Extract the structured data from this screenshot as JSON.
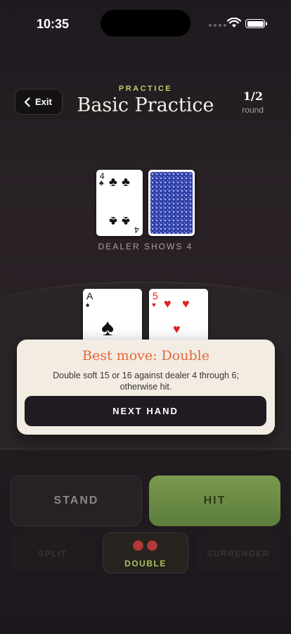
{
  "status": {
    "time": "10:35"
  },
  "header": {
    "exit_label": "Exit",
    "mode": "PRACTICE",
    "title": "Basic Practice",
    "round_count": "1/2",
    "round_label": "round"
  },
  "dealer": {
    "up_card": {
      "rank": "4",
      "suit": "♣"
    },
    "hole_card": "face-down",
    "caption": "DEALER SHOWS 4"
  },
  "player": {
    "cards": [
      {
        "rank": "A",
        "suit": "♠"
      },
      {
        "rank": "5",
        "suit": "♥"
      }
    ]
  },
  "hint": {
    "title": "Best move: Double",
    "text": "Double soft 15 or 16 against dealer 4 through 6; otherwise hit.",
    "next_label": "NEXT HAND"
  },
  "actions": {
    "stand": "STAND",
    "hit": "HIT",
    "split": "SPLIT",
    "double": "DOUBLE",
    "surrender": "SURRENDER"
  },
  "colors": {
    "accent_green": "#b9d36a",
    "hint_title": "#e4683a",
    "hit_button": "#6b8b45"
  }
}
